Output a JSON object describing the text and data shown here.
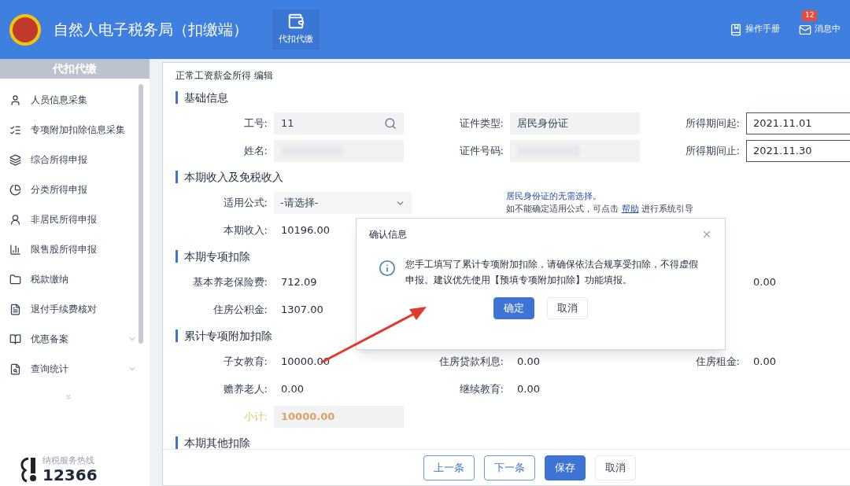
{
  "header": {
    "title": "自然人电子税务局（扣缴端）",
    "nav": [
      {
        "label": "代扣代缴",
        "selected": true
      }
    ],
    "links": [
      {
        "label": "操作手册",
        "kind": "manual"
      },
      {
        "label": "消息中",
        "kind": "message",
        "badge": "12"
      }
    ]
  },
  "sidebar": {
    "title": "代扣代缴",
    "items": [
      {
        "label": "人员信息采集",
        "expandable": false
      },
      {
        "label": "专项附加扣除信息采集",
        "expandable": false
      },
      {
        "label": "综合所得申报",
        "expandable": false
      },
      {
        "label": "分类所得申报",
        "expandable": false
      },
      {
        "label": "非居民所得申报",
        "expandable": false
      },
      {
        "label": "限售股所得申报",
        "expandable": false
      },
      {
        "label": "税款缴纳",
        "expandable": false
      },
      {
        "label": "退付手续费核对",
        "expandable": false
      },
      {
        "label": "优惠备案",
        "expandable": true
      },
      {
        "label": "查询统计",
        "expandable": true
      }
    ],
    "hotline_label": "纳税服务热线",
    "hotline_number": "12366"
  },
  "form": {
    "title": "正常工资薪金所得 编辑",
    "sections": [
      {
        "title": "基础信息",
        "rows": [
          [
            {
              "label": "工号:",
              "value": "11",
              "kind": "search"
            },
            {
              "label": "证件类型:",
              "value": "居民身份证",
              "kind": "readonly"
            },
            {
              "label": "所得期间起:",
              "value": "2021.11.01",
              "kind": "date"
            }
          ],
          [
            {
              "label": "姓名:",
              "kind": "blurred"
            },
            {
              "label": "证件号码:",
              "kind": "blurred"
            },
            {
              "label": "所得期间止:",
              "value": "2021.11.30",
              "kind": "date"
            }
          ]
        ]
      },
      {
        "title": "本期收入及免税收入",
        "rows": [
          [
            {
              "label": "适用公式:",
              "value": "-请选择-",
              "kind": "select",
              "note": "居民身份证的无需选择。",
              "hint": "如不能确定适用公式，可点击",
              "link": "帮助",
              "hint_end": "进行系统引导"
            }
          ],
          [
            {
              "label": "本期收入:",
              "value": "10196.00",
              "kind": "text"
            }
          ]
        ]
      },
      {
        "title": "本期专项扣除",
        "rows": [
          [
            {
              "label": "基本养老保险费:",
              "value": "712.09",
              "kind": "text"
            },
            {
              "kind": "gap"
            },
            {
              "value": "0.00",
              "kind": "text"
            }
          ],
          [
            {
              "label": "住房公积金:",
              "value": "1307.00",
              "kind": "text"
            }
          ]
        ]
      },
      {
        "title": "累计专项附加扣除",
        "rows": [
          [
            {
              "label": "子女教育:",
              "value": "10000.00",
              "kind": "text"
            },
            {
              "label": "住房贷款利息:",
              "value": "0.00",
              "kind": "text"
            },
            {
              "label": "住房租金:",
              "value": "0.00",
              "kind": "text"
            }
          ],
          [
            {
              "label": "赡养老人:",
              "value": "0.00",
              "kind": "text"
            },
            {
              "label": "继续教育:",
              "value": "0.00",
              "kind": "text"
            }
          ],
          [
            {
              "label": "小计:",
              "value": "10000.00",
              "kind": "total"
            }
          ]
        ]
      },
      {
        "title": "本期其他扣除"
      }
    ],
    "buttons": [
      {
        "label": "上一条",
        "kind": "outline"
      },
      {
        "label": "下一条",
        "kind": "outline"
      },
      {
        "label": "保存",
        "kind": "primary"
      },
      {
        "label": "取消",
        "kind": "plain"
      }
    ]
  },
  "dialog": {
    "title": "确认信息",
    "message": "您手工填写了累计专项附加扣除，请确保依法合规享受扣除，不得虚假申报。建议优先使用【预填专项附加扣除】功能填报。",
    "buttons": [
      {
        "label": "确定",
        "kind": "primary"
      },
      {
        "label": "取消",
        "kind": "plain"
      }
    ]
  }
}
